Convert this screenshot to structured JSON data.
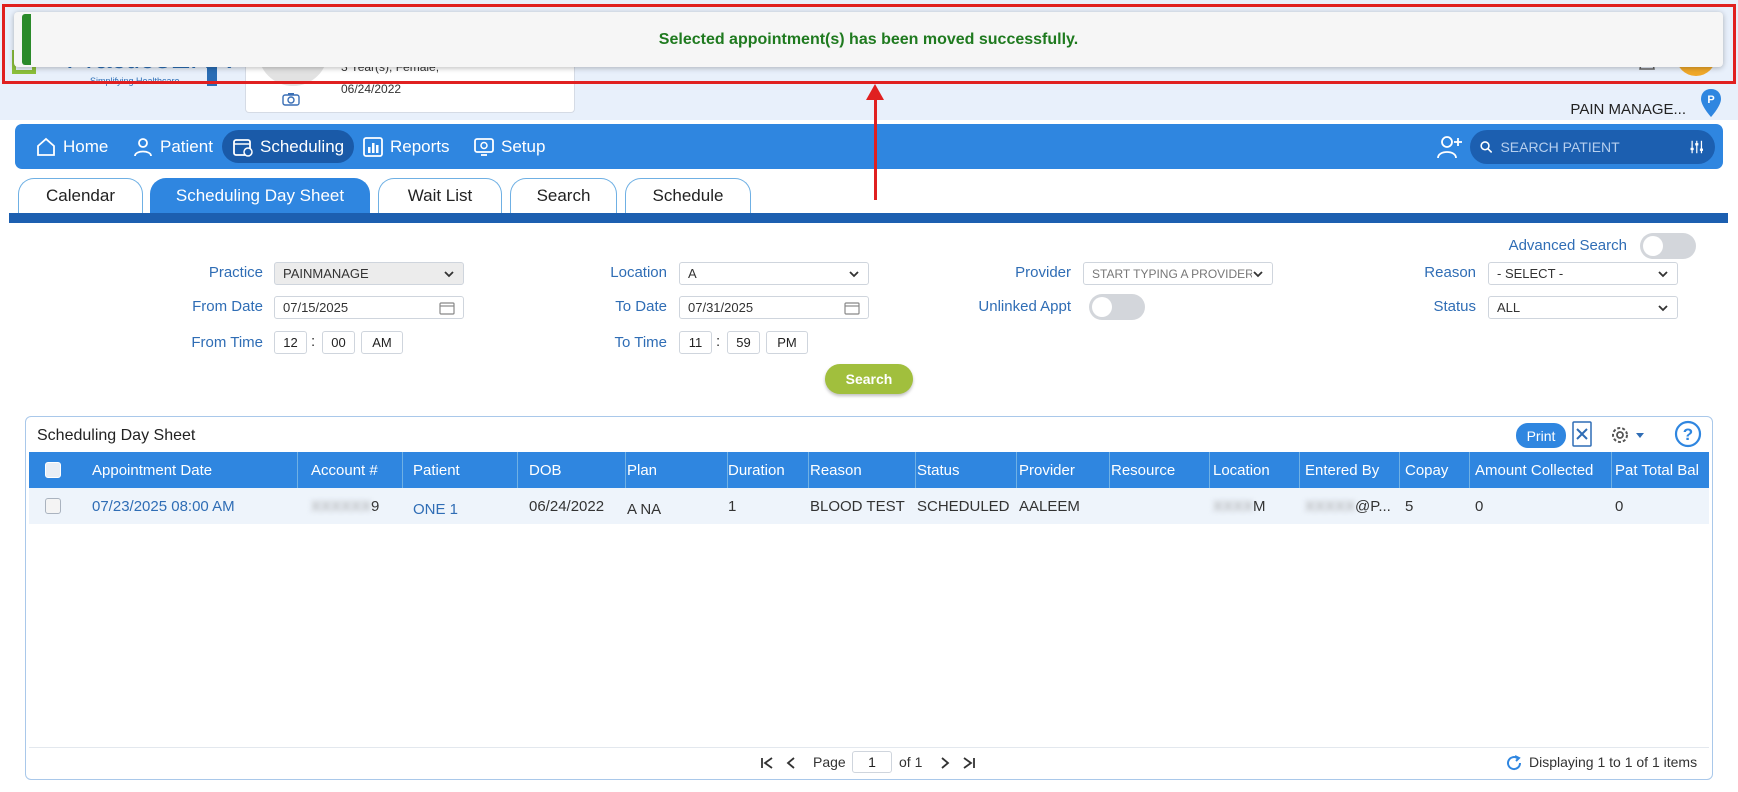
{
  "header": {
    "logo_text": "PracticeEHR",
    "logo_sub": "Simplifying Healthcare",
    "patient_line1": "3 Year(s), Female,",
    "patient_line2": "06/24/2022",
    "practice_label": "PAIN MANAGE..."
  },
  "nav": {
    "items": [
      {
        "label": "Home",
        "icon": "home-icon"
      },
      {
        "label": "Patient",
        "icon": "person-icon"
      },
      {
        "label": "Scheduling",
        "icon": "calendar-clock-icon"
      },
      {
        "label": "Reports",
        "icon": "bar-chart-icon"
      },
      {
        "label": "Setup",
        "icon": "monitor-gear-icon"
      }
    ],
    "active": "Scheduling",
    "search_placeholder": "SEARCH PATIENT"
  },
  "tabs": {
    "items": [
      "Calendar",
      "Scheduling Day Sheet",
      "Wait List",
      "Search",
      "Schedule"
    ],
    "active": "Scheduling Day Sheet"
  },
  "filters": {
    "advanced_search_label": "Advanced Search",
    "practice_label": "Practice",
    "practice_value": "PAINMANAGE",
    "location_label": "Location",
    "location_value": "A",
    "provider_label": "Provider",
    "provider_placeholder": "START TYPING A PROVIDER",
    "reason_label": "Reason",
    "reason_value": "- SELECT -",
    "from_date_label": "From Date",
    "from_date_value": "07/15/2025",
    "to_date_label": "To Date",
    "to_date_value": "07/31/2025",
    "unlinked_label": "Unlinked Appt",
    "status_label": "Status",
    "status_value": "ALL",
    "from_time_label": "From Time",
    "from_hour": "12",
    "from_min": "00",
    "from_ampm": "AM",
    "to_time_label": "To Time",
    "to_hour": "11",
    "to_min": "59",
    "to_ampm": "PM",
    "search_button": "Search"
  },
  "grid": {
    "title": "Scheduling Day Sheet",
    "print_label": "Print",
    "columns": [
      "Appointment Date",
      "Account #",
      "Patient",
      "DOB",
      "Plan",
      "Duration",
      "Reason",
      "Status",
      "Provider",
      "Resource",
      "Location",
      "Entered By",
      "Copay",
      "Amount Collected",
      "Pat Total Bal"
    ],
    "rows": [
      {
        "appointment_date": "07/23/2025 08:00 AM",
        "account": "9",
        "patient": "ONE 1",
        "dob": "06/24/2022",
        "plan": "A NA",
        "duration": "1",
        "reason": "BLOOD TEST",
        "status": "SCHEDULED",
        "provider": "AALEEM",
        "resource": "",
        "location": "M",
        "entered_by": "@P...",
        "copay": "5",
        "amount_collected": "0",
        "pat_total_bal": "0"
      }
    ],
    "pager": {
      "page_label": "Page",
      "page_value": "1",
      "of_label": "of 1",
      "display_text": "Displaying 1 to 1 of 1 items"
    }
  },
  "toast": {
    "message": "Selected appointment(s) has been moved successfully."
  },
  "colors": {
    "nav_blue": "#2f86e0",
    "nav_dark": "#1a5aa8",
    "label_blue": "#2f6db5",
    "search_green": "#a1bf3d",
    "toast_green": "#1f7a1f",
    "annotation_red": "#e02020"
  }
}
